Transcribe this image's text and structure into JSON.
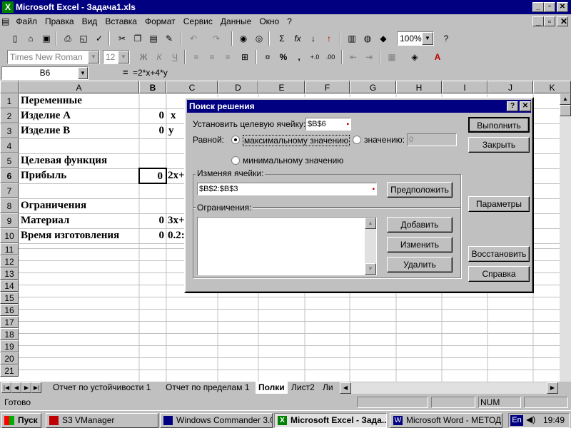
{
  "app": {
    "title": "Microsoft Excel - Задача1.xls",
    "min": "_",
    "max": "▫",
    "close": "✕"
  },
  "menu": [
    "Файл",
    "Правка",
    "Вид",
    "Вставка",
    "Формат",
    "Сервис",
    "Данные",
    "Окно",
    "?"
  ],
  "toolbar": {
    "zoom": "100%",
    "font": "Times New Roman",
    "size": "12",
    "bold": "Ж",
    "italic": "К",
    "underline": "Ч",
    "percent": "%",
    "comma": ","
  },
  "formula_bar": {
    "cell_ref": "B6",
    "eq": "=",
    "formula": "=2*x+4*y"
  },
  "columns": [
    "A",
    "B",
    "C",
    "D",
    "E",
    "F",
    "G",
    "H",
    "I",
    "J",
    "K"
  ],
  "rows": [
    "1",
    "2",
    "3",
    "4",
    "5",
    "6",
    "7",
    "8",
    "9",
    "10",
    "11",
    "12",
    "13",
    "14",
    "15",
    "16",
    "17",
    "18",
    "19",
    "20",
    "21"
  ],
  "cells": {
    "a1": "Переменные",
    "a2": "Изделие A",
    "b2": "0",
    "c2": "x",
    "a3": "Изделие B",
    "b3": "0",
    "c3": "y",
    "a5": "Целевая функция",
    "a6": "Прибыль",
    "b6": "0",
    "c6": "2x+",
    "a8": "Ограничения",
    "a9": "Материал",
    "b9": "0",
    "c9": "3x+",
    "a10": "Время изготовления",
    "b10": "0",
    "c10": "0.2:"
  },
  "sheet_tabs": [
    "Отчет по устойчивости 1",
    "Отчет по пределам 1",
    "Полки",
    "Лист2",
    "Ли"
  ],
  "status": {
    "ready": "Готово",
    "num": "NUM"
  },
  "taskbar": {
    "start": "Пуск",
    "items": [
      "S3 VManager",
      "Windows Commander 3.0...",
      "Microsoft Excel - Зада...",
      "Microsoft Word - МЕТОД..."
    ],
    "lang": "En",
    "time": "19:49"
  },
  "dialog": {
    "title": "Поиск решения",
    "help": "?",
    "close": "✕",
    "target_label": "Установить целевую ячейку:",
    "target_value": "$B$6",
    "equal_label": "Равной:",
    "max_label": "максимальному значению",
    "value_label": "значению:",
    "value_input": "0",
    "min_label": "минимальному значению",
    "changing_label": "Изменяя ячейки:",
    "changing_value": "$B$2:$B$3",
    "constraints_label": "Ограничения:",
    "btn_solve": "Выполнить",
    "btn_close": "Закрыть",
    "btn_guess": "Предположить",
    "btn_options": "Параметры",
    "btn_add": "Добавить",
    "btn_change": "Изменить",
    "btn_delete": "Удалить",
    "btn_reset": "Восстановить",
    "btn_help": "Справка"
  }
}
